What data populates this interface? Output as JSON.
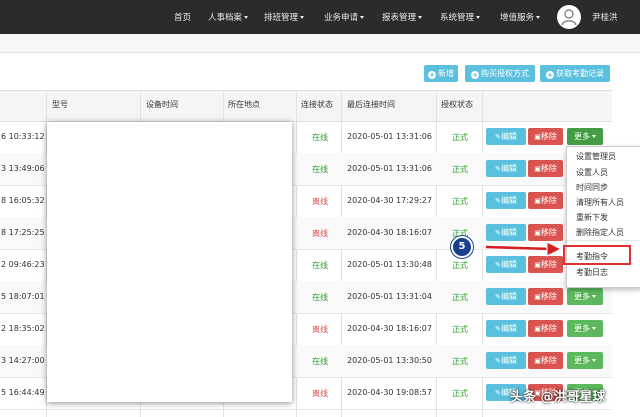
{
  "nav": {
    "items": [
      {
        "label": "首页",
        "has_caret": false
      },
      {
        "label": "人事档案",
        "has_caret": true
      },
      {
        "label": "排班管理",
        "has_caret": true
      },
      {
        "label": "业务申请",
        "has_caret": true
      },
      {
        "label": "报表管理",
        "has_caret": true
      },
      {
        "label": "系统管理",
        "has_caret": true
      },
      {
        "label": "增值服务",
        "has_caret": true
      }
    ],
    "username": "尹桂洪"
  },
  "toolbar": {
    "new_label": "新增",
    "buy_license_label": "购买授权方式",
    "fetch_records_label": "获取考勤记录"
  },
  "table": {
    "headers": {
      "model": "型号",
      "device_time": "设备时间",
      "location": "所在地点",
      "conn_status": "连接状态",
      "last_conn_time": "最后连接时间",
      "license_status": "授权状态"
    },
    "rows": [
      {
        "time": "6 10:33:12",
        "status": "在线",
        "last": "2020-05-01 13:31:06",
        "license": "正式"
      },
      {
        "time": "3 13:49:06",
        "status": "在线",
        "last": "2020-05-01 13:31:06",
        "license": "正式"
      },
      {
        "time": "8 16:05:32",
        "status": "离线",
        "last": "2020-04-30 17:29:27",
        "license": "正式"
      },
      {
        "time": "8 17:25:25",
        "status": "离线",
        "last": "2020-04-30 18:16:07",
        "license": "正式"
      },
      {
        "time": "2 09:46:23",
        "status": "在线",
        "last": "2020-05-01 13:30:48",
        "license": "正式"
      },
      {
        "time": "5 18:07:01",
        "status": "在线",
        "last": "2020-05-01 13:31:04",
        "license": "正式"
      },
      {
        "time": "2 18:35:02",
        "status": "离线",
        "last": "2020-04-30 18:16:07",
        "license": "正式"
      },
      {
        "time": "3 14:27:00",
        "status": "在线",
        "last": "2020-05-01 13:30:50",
        "license": "正式"
      },
      {
        "time": "5 16:44:49",
        "status": "离线",
        "last": "2020-04-30 19:08:57",
        "license": "正式"
      }
    ],
    "edit_label": "编辑",
    "delete_label": "移除",
    "more_label": "更多"
  },
  "dropdown": {
    "items": [
      "设置管理员",
      "设置人员",
      "时间同步",
      "清理所有人员",
      "重新下发",
      "删除指定人员"
    ],
    "highlighted_item": "考勤指令",
    "last_item": "考勤日志"
  },
  "annotation": {
    "step_number": "5"
  },
  "watermark": "头条 @洪哥星球",
  "colors": {
    "topbar": "#2b2b2b",
    "info": "#5bc0de",
    "danger": "#d9534f",
    "success": "#5cb85c",
    "online_text": "#2ca02c",
    "offline_text": "#d9534f",
    "highlight": "#e03030",
    "badge": "#1a3f8f"
  }
}
